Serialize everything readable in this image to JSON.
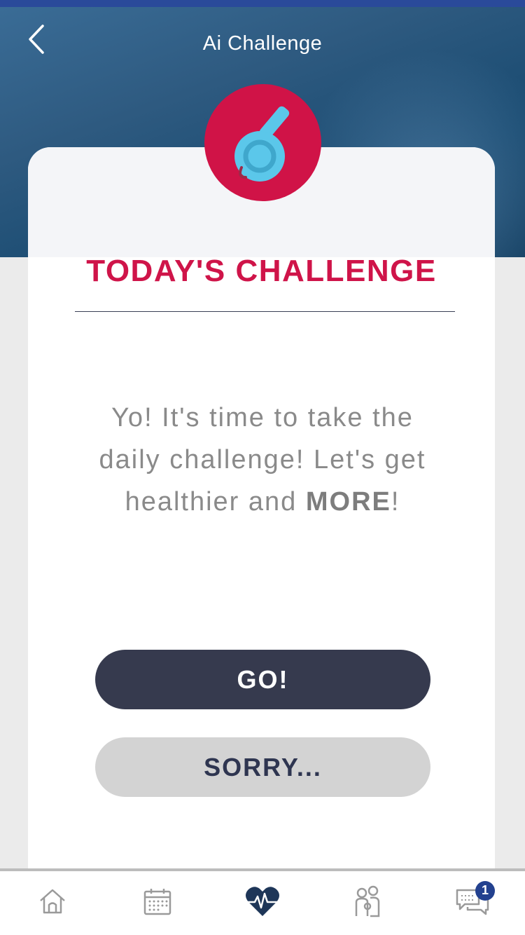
{
  "header": {
    "title": "Ai Challenge",
    "back_icon": "chevron-left-icon"
  },
  "badge": {
    "icon": "whistle-icon",
    "color": "#d01347"
  },
  "challenge": {
    "heading": "TODAY'S CHALLENGE",
    "message_part1": "Yo! It's time to take the daily challenge! Let's get healthier and ",
    "message_emphasis": "MORE",
    "message_part2": "!"
  },
  "actions": {
    "go_label": "GO!",
    "sorry_label": "SORRY..."
  },
  "tabbar": {
    "items": [
      {
        "icon": "home-icon",
        "active": false
      },
      {
        "icon": "calendar-icon",
        "active": false
      },
      {
        "icon": "heart-pulse-icon",
        "active": true
      },
      {
        "icon": "family-icon",
        "active": false
      },
      {
        "icon": "chat-icon",
        "active": false,
        "badge": "1"
      }
    ]
  },
  "colors": {
    "accent": "#cf1449",
    "primary_button": "#363a4e",
    "secondary_button": "#d3d3d3",
    "notification": "#23418f"
  }
}
